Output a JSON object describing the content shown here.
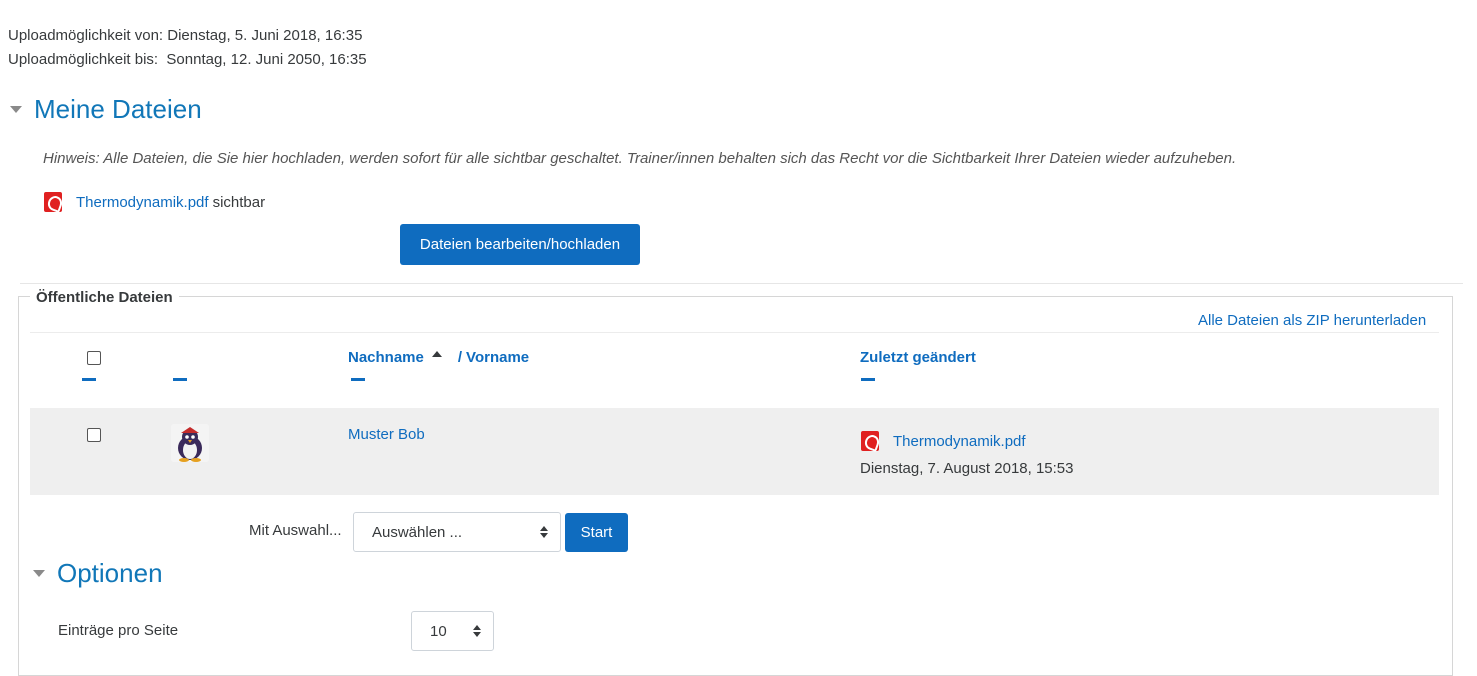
{
  "upload": {
    "from_label": "Uploadmöglichkeit von:",
    "from_value": "Dienstag, 5. Juni 2018, 16:35",
    "to_label": "Uploadmöglichkeit bis:",
    "to_value": "Sonntag, 12. Juni 2050, 16:35"
  },
  "my_files": {
    "title": "Meine Dateien",
    "hint": "Hinweis: Alle Dateien, die Sie hier hochladen, werden sofort für alle sichtbar geschaltet. Trainer/innen behalten sich das Recht vor die Sichtbarkeit Ihrer Dateien wieder aufzuheben.",
    "file_name": "Thermodynamik.pdf",
    "file_status": "sichtbar",
    "edit_button": "Dateien bearbeiten/hochladen"
  },
  "public_files": {
    "legend": "Öffentliche Dateien",
    "zip_link": "Alle Dateien als ZIP herunterladen",
    "columns": {
      "lastname": "Nachname",
      "separator": "/",
      "firstname": "Vorname",
      "modified": "Zuletzt geändert"
    },
    "rows": [
      {
        "name": "Muster Bob",
        "file": "Thermodynamik.pdf",
        "date": "Dienstag, 7. August 2018, 15:53"
      }
    ],
    "with_selection_label": "Mit Auswahl...",
    "select_value": "Auswählen ...",
    "start_button": "Start"
  },
  "options": {
    "title": "Optionen",
    "per_page_label": "Einträge pro Seite",
    "per_page_value": "10"
  },
  "colors": {
    "link": "#0f6cbf",
    "heading": "#1177b8",
    "pdf_red": "#e02020",
    "row_bg": "#efefef"
  },
  "icons": {
    "pdf": "pdf-icon",
    "collapse": "triangle-down-icon",
    "sort": "sort-ascending-icon",
    "select_arrows": "updown-arrows-icon"
  }
}
